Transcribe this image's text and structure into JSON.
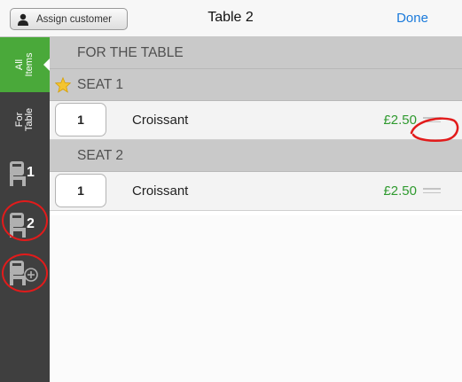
{
  "header": {
    "assign_label": "Assign customer",
    "title": "Table 2",
    "done_label": "Done"
  },
  "sidebar": {
    "tabs": [
      {
        "label": "All Items",
        "active": true
      },
      {
        "label": "For Table",
        "active": false
      }
    ],
    "seats": [
      {
        "number": "1",
        "icon": "chair-icon"
      },
      {
        "number": "2",
        "icon": "chair-icon",
        "circled": true
      },
      {
        "number": "",
        "icon": "add-seat-icon",
        "circled": true
      }
    ]
  },
  "sections": [
    {
      "label": "FOR THE TABLE",
      "items": []
    },
    {
      "label": "SEAT 1",
      "icon": "star-icon",
      "items": [
        {
          "qty": "1",
          "name": "Croissant",
          "price": "£2.50",
          "grip_circled": true
        }
      ]
    },
    {
      "label": "SEAT 2",
      "items": [
        {
          "qty": "1",
          "name": "Croissant",
          "price": "£2.50"
        }
      ]
    }
  ],
  "colors": {
    "accent_green": "#4aa93a",
    "price_green": "#2f9a2f",
    "link_blue": "#1a7adb",
    "sidebar_bg": "#3f3f3f",
    "annotation_red": "#e21b1b"
  }
}
